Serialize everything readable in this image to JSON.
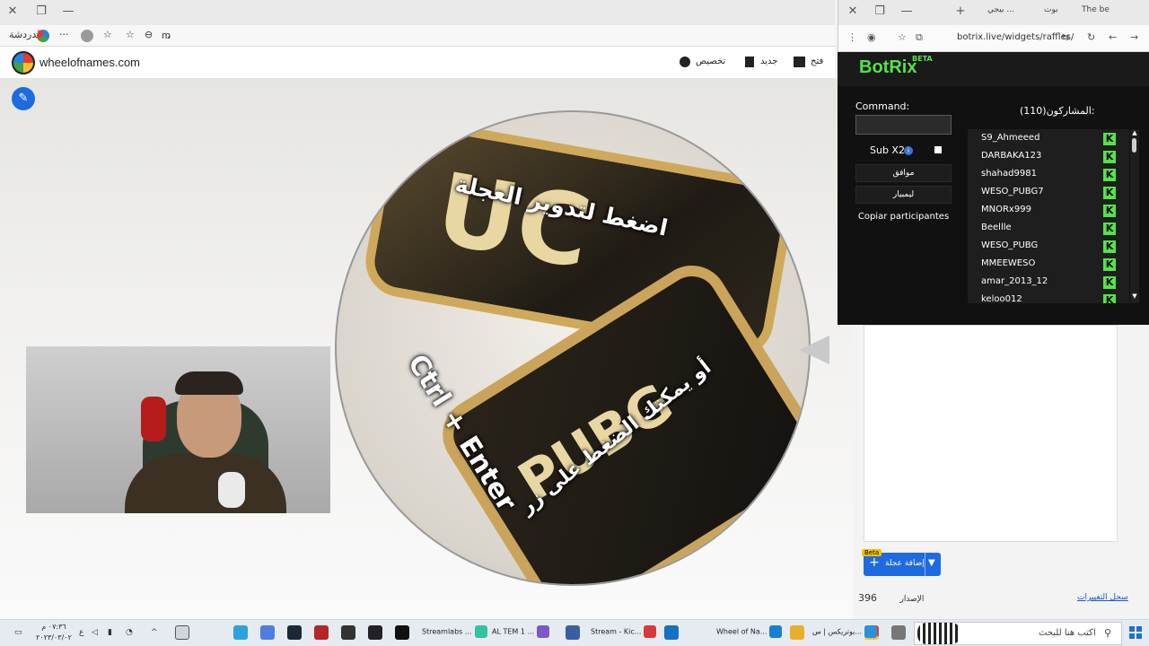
{
  "main_browser": {
    "window_controls": {
      "close": "✕",
      "restore": "❐",
      "minimize": "—"
    },
    "address_bar": {
      "profile_label": "الدردشة",
      "more": "···"
    }
  },
  "site": {
    "name": "wheelofnames.com",
    "nav": {
      "customize": "تخصيص",
      "new": "جديد",
      "open": "فتح"
    },
    "colors": {
      "accent": "#1e6be0"
    }
  },
  "wheel": {
    "main_text": "اضغط لتدوير العجلة",
    "shortcut_text": "Ctrl + Enter",
    "hint_text": "أو يمكنك الضغط على زر",
    "card_letters": [
      "UC",
      "PUBG"
    ]
  },
  "right_pane": {
    "add_button": "إضافة عجلة",
    "beta": "Beta",
    "version_label": "الإصدار",
    "version_value": "396",
    "changelog": "سجل التغييرات"
  },
  "overlay_browser": {
    "tabs": [
      "The be",
      "بوت",
      "بيجي ..."
    ],
    "url": "botrix.live/widgets/raffles/"
  },
  "botrix": {
    "logo": "BotRix",
    "beta": "BETA",
    "command_label": "Command:",
    "sub_label": "Sub X2",
    "accept_button": "موافق",
    "reset_button": "ليمبيار",
    "copy_button": "Copiar participantes",
    "participants_title": "المشاركون(110):",
    "participants": [
      "S9_Ahmeeed",
      "DARBAKA123",
      "shahad9981",
      "WESO_PUBG7",
      "MNORx999",
      "Beellle",
      "WESO_PUBG",
      "MMEEWESO",
      "amar_2013_12",
      "keloo012"
    ],
    "kick_icon": "K",
    "colors": {
      "brand": "#54e34a"
    }
  },
  "taskbar": {
    "search_placeholder": "اكتب هنا للبحث",
    "apps": [
      "بوتريكس | س...",
      "Wheel of Na...",
      "Stream - Kic...",
      "AL TEM 1 ...",
      "Streamlabs ..."
    ],
    "clock_time": "٠٧:٣٦ م",
    "clock_date": "٢٠٢٣/٠٣/٠٢",
    "lang": "ع"
  }
}
